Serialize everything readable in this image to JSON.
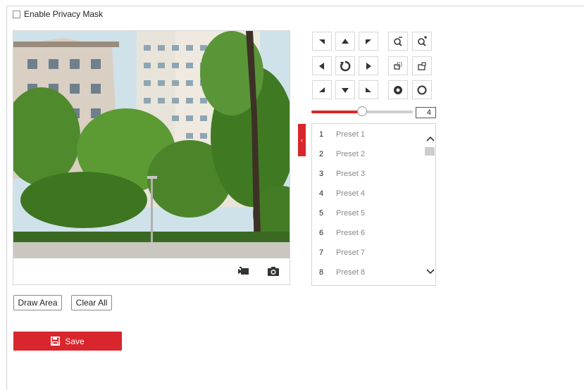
{
  "privacy_mask": {
    "label": "Enable Privacy Mask",
    "checked": false
  },
  "video": {
    "toolbar": {
      "record_icon": "record-icon",
      "capture_icon": "camera-icon"
    }
  },
  "ptz": {
    "buttons": [
      {
        "name": "pan-up-left-button",
        "icon": "arrow-up-left"
      },
      {
        "name": "pan-up-button",
        "icon": "arrow-up"
      },
      {
        "name": "pan-up-right-button",
        "icon": "arrow-up-right"
      },
      {
        "name": "zoom-out-button",
        "icon": "zoom-out-icon"
      },
      {
        "name": "zoom-in-button",
        "icon": "zoom-in-icon"
      },
      {
        "name": "pan-left-button",
        "icon": "arrow-left"
      },
      {
        "name": "auto-scan-button",
        "icon": "refresh-icon"
      },
      {
        "name": "pan-right-button",
        "icon": "arrow-right"
      },
      {
        "name": "focus-near-button",
        "icon": "focus-near-icon"
      },
      {
        "name": "focus-far-button",
        "icon": "focus-far-icon"
      },
      {
        "name": "pan-down-left-button",
        "icon": "arrow-down-left"
      },
      {
        "name": "pan-down-button",
        "icon": "arrow-down"
      },
      {
        "name": "pan-down-right-button",
        "icon": "arrow-down-right"
      },
      {
        "name": "iris-open-button",
        "icon": "iris-open-icon"
      },
      {
        "name": "iris-close-button",
        "icon": "iris-close-icon"
      }
    ],
    "speed": {
      "value": "4",
      "fraction": 0.5
    }
  },
  "presets": [
    {
      "num": "1",
      "name": "Preset 1"
    },
    {
      "num": "2",
      "name": "Preset 2"
    },
    {
      "num": "3",
      "name": "Preset 3"
    },
    {
      "num": "4",
      "name": "Preset 4"
    },
    {
      "num": "5",
      "name": "Preset 5"
    },
    {
      "num": "6",
      "name": "Preset 6"
    },
    {
      "num": "7",
      "name": "Preset 7"
    },
    {
      "num": "8",
      "name": "Preset 8"
    }
  ],
  "actions": {
    "draw_area": "Draw Area",
    "clear_all": "Clear All",
    "save": "Save"
  },
  "colors": {
    "accent": "#d9262c",
    "border": "#d6d6d6"
  }
}
